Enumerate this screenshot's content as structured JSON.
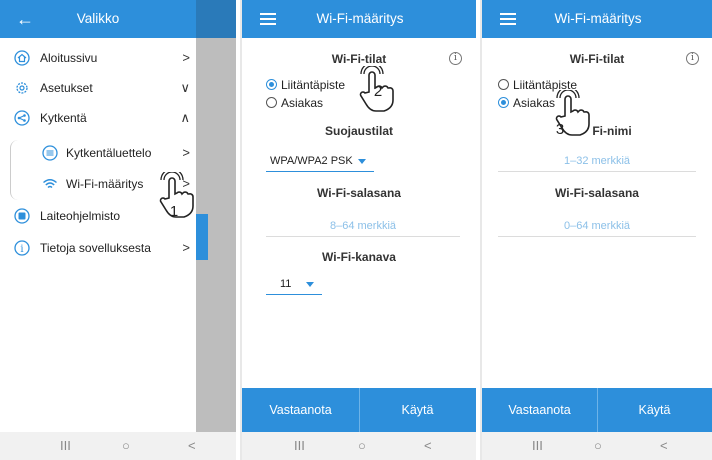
{
  "menu_panel": {
    "title": "Valikko",
    "items": [
      {
        "label": "Aloitussivu",
        "chev": ">"
      },
      {
        "label": "Asetukset",
        "chev": "∨"
      },
      {
        "label": "Kytkentä",
        "chev": "∧"
      },
      {
        "label": "Kytkentäluettelo",
        "chev": ">"
      },
      {
        "label": "Wi-Fi-määritys",
        "chev": ">"
      },
      {
        "label": "Laiteohjelmisto",
        "chev": ""
      },
      {
        "label": "Tietoja sovelluksesta",
        "chev": ">"
      }
    ],
    "step": "1"
  },
  "wifi_panel_ap": {
    "title": "Wi-Fi-määritys",
    "mode_heading": "Wi-Fi-tilat",
    "radio_ap": "Liitäntäpiste",
    "radio_client": "Asiakas",
    "selected_mode": "Liitäntäpiste",
    "security_heading": "Suojaustilat",
    "security_value": "WPA/WPA2 PSK",
    "password_heading": "Wi-Fi-salasana",
    "password_placeholder": "8–64 merkkiä",
    "channel_heading": "Wi-Fi-kanava",
    "channel_value": "11",
    "btn_receive": "Vastaanota",
    "btn_apply": "Käytä",
    "step": "2"
  },
  "wifi_panel_client": {
    "title": "Wi-Fi-määritys",
    "mode_heading": "Wi-Fi-tilat",
    "radio_ap": "Liitäntäpiste",
    "radio_client": "Asiakas",
    "selected_mode": "Asiakas",
    "name_heading": "Wi-Fi-nimi",
    "name_heading_visible": "Fi-nimi",
    "name_placeholder": "1–32 merkkiä",
    "password_heading": "Wi-Fi-salasana",
    "password_placeholder": "0–64 merkkiä",
    "btn_receive": "Vastaanota",
    "btn_apply": "Käytä",
    "step": "3"
  },
  "android_nav": {
    "recent": "III",
    "home": "○",
    "back": "<"
  },
  "colors": {
    "accent": "#2d8fdb",
    "scrim": "#bdbdbd"
  },
  "icons": [
    "back-arrow-icon",
    "home-icon",
    "settings-icon",
    "connection-icon",
    "list-icon",
    "wifi-icon",
    "firmware-icon",
    "info-icon",
    "menu-icon",
    "hand-tap-icon"
  ]
}
